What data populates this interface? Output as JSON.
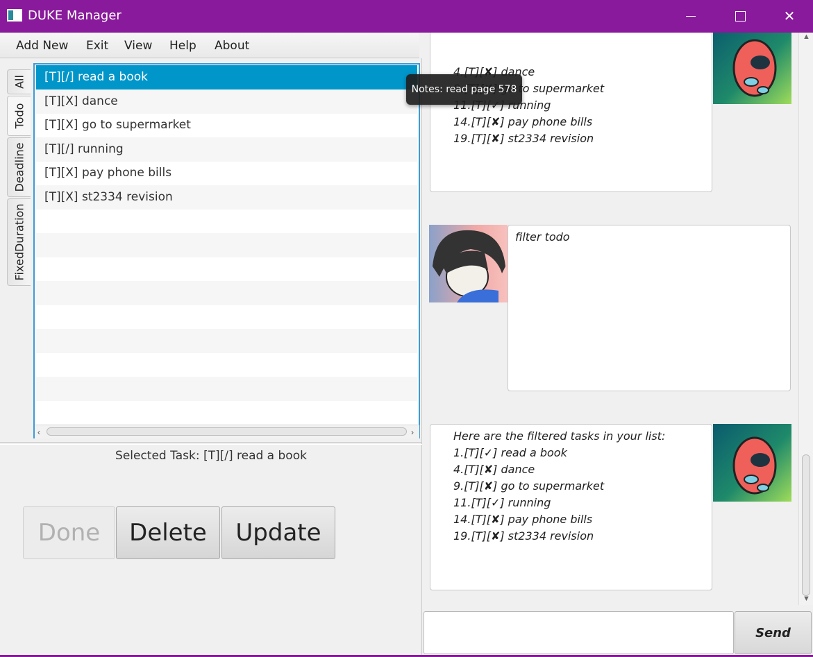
{
  "window": {
    "title": "DUKE Manager",
    "accent_color": "#891a9b"
  },
  "menu": {
    "items": [
      "Add New",
      "Exit",
      "View",
      "Help",
      "About"
    ]
  },
  "tabs": [
    {
      "label": "All",
      "active": false
    },
    {
      "label": "Todo",
      "active": true
    },
    {
      "label": "Deadline",
      "active": false
    },
    {
      "label": "FixedDuration",
      "active": false
    }
  ],
  "task_list": {
    "items": [
      "[T][/] read a book",
      "[T][X] dance",
      "[T][X] go to supermarket",
      "[T][/] running",
      "[T][X] pay phone bills",
      "[T][X] st2334 revision"
    ],
    "selected_index": 0,
    "selection_color": "#0096c9"
  },
  "selected_task": {
    "text": "Selected Task: [T][/] read a book"
  },
  "actions": {
    "done": "Done",
    "delete": "Delete",
    "update": "Update"
  },
  "tooltip": {
    "text": "Notes: read page 578"
  },
  "chat": {
    "top_bubble_lines": [
      "4.[T][✘] dance",
      "9.[T][✘] go to supermarket",
      "11.[T][✓] running",
      "14.[T][✘] pay phone bills",
      "19.[T][✘] st2334 revision"
    ],
    "user_message": "filter todo",
    "bottom_bubble_lines": [
      "Here are the filtered tasks in your list:",
      "1.[T][✓] read a book",
      "4.[T][✘] dance",
      "9.[T][✘] go to supermarket",
      "11.[T][✓] running",
      "14.[T][✘] pay phone bills",
      "19.[T][✘] st2334 revision"
    ]
  },
  "input": {
    "value": "",
    "send_label": "Send"
  }
}
